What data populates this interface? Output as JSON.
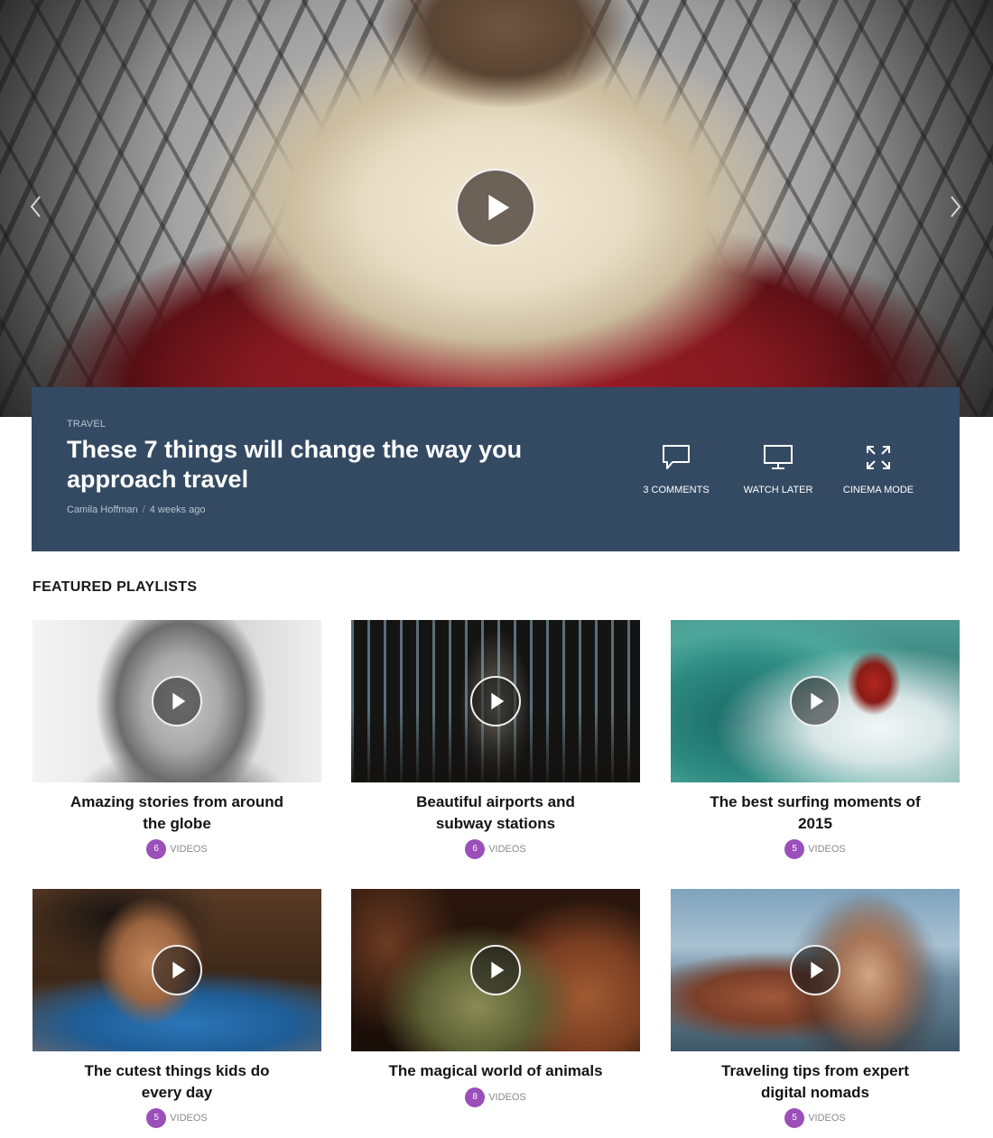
{
  "hero": {
    "featured": {
      "category": "TRAVEL",
      "title": "These 7 things will change the way you approach travel",
      "author": "Camila Hoffman",
      "separator": "/",
      "date": "4 weeks ago"
    },
    "actions": {
      "comments": {
        "label": "3 COMMENTS",
        "icon": "comment-icon"
      },
      "watch_later": {
        "label": "WATCH LATER",
        "icon": "monitor-icon"
      },
      "cinema_mode": {
        "label": "CINEMA MODE",
        "icon": "expand-icon"
      }
    }
  },
  "playlists": {
    "section_title": "FEATURED PLAYLISTS",
    "videos_label": "VIDEOS",
    "items": [
      {
        "title": "Amazing stories from around the globe",
        "count": "6"
      },
      {
        "title": "Beautiful airports and subway stations",
        "count": "6"
      },
      {
        "title": "The best surfing moments of 2015",
        "count": "5"
      },
      {
        "title": "The cutest things kids do every day",
        "count": "5"
      },
      {
        "title": "The magical world of animals",
        "count": "8"
      },
      {
        "title": "Traveling tips from expert digital nomads",
        "count": "5"
      }
    ]
  },
  "colors": {
    "panel_bg": "#344a63",
    "badge": "#9b4fb8",
    "meta_text": "#b7c2cf"
  }
}
